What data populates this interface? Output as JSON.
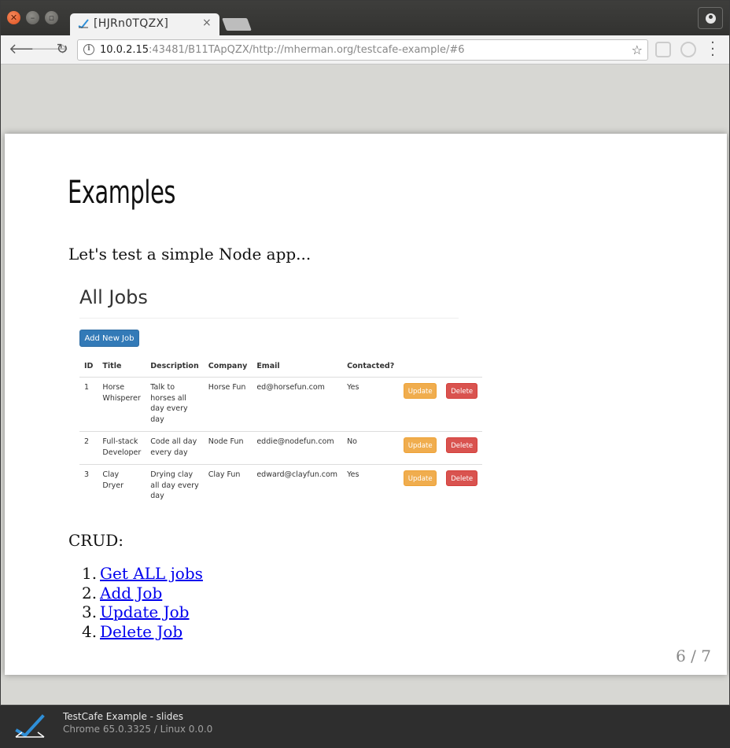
{
  "browser": {
    "tab_title": "[HJRn0TQZX]",
    "tab_close": "×",
    "url_host": "10.0.2.15",
    "url_rest": ":43481/B11TApQZX/http://mherman.org/testcafe-example/#6"
  },
  "slide": {
    "title": "Examples",
    "intro": "Let's test a simple Node app...",
    "app": {
      "heading": "All Jobs",
      "add_button": "Add New Job",
      "columns": [
        "ID",
        "Title",
        "Description",
        "Company",
        "Email",
        "Contacted?"
      ],
      "rows": [
        {
          "id": "1",
          "title": "Horse Whisperer",
          "description": "Talk to horses all day every day",
          "company": "Horse Fun",
          "email": "ed@horsefun.com",
          "contacted": "Yes"
        },
        {
          "id": "2",
          "title": "Full-stack Developer",
          "description": "Code all day every day",
          "company": "Node Fun",
          "email": "eddie@nodefun.com",
          "contacted": "No"
        },
        {
          "id": "3",
          "title": "Clay Dryer",
          "description": "Drying clay all day every day",
          "company": "Clay Fun",
          "email": "edward@clayfun.com",
          "contacted": "Yes"
        }
      ],
      "update_label": "Update",
      "delete_label": "Delete"
    },
    "crud_label": "CRUD:",
    "links": [
      {
        "num": "1.",
        "label": "Get ALL jobs"
      },
      {
        "num": "2.",
        "label": "Add Job"
      },
      {
        "num": "3.",
        "label": "Update Job"
      },
      {
        "num": "4.",
        "label": "Delete Job"
      }
    ],
    "page_indicator": "6 / 7"
  },
  "taskbar": {
    "title": "TestCafe Example - slides",
    "subtitle": "Chrome 65.0.3325 / Linux 0.0.0"
  },
  "colors": {
    "primary": "#337ab7",
    "warning": "#f0ad4e",
    "danger": "#d9534f",
    "link": "#0000ee"
  }
}
